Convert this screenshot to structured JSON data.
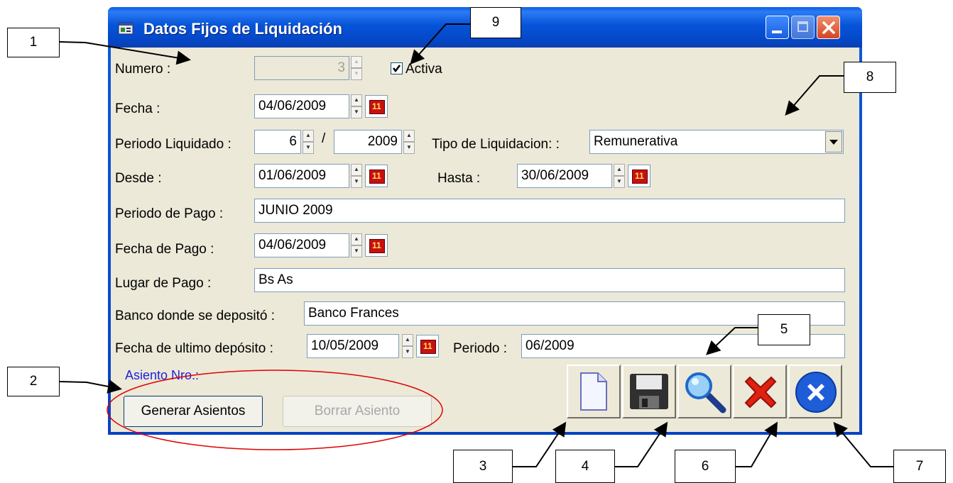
{
  "window": {
    "title": "Datos Fijos de Liquidación"
  },
  "form": {
    "numero_label": "Numero :",
    "numero_value": "3",
    "activa_label": "Activa",
    "activa_checked": true,
    "fecha_label": "Fecha :",
    "fecha_value": "04/06/2009",
    "periodo_liquidado_label": "Periodo Liquidado :",
    "periodo_mes": "6",
    "periodo_sep": "/",
    "periodo_anio": "2009",
    "tipo_label": "Tipo de Liquidacion: :",
    "tipo_value": "Remunerativa",
    "desde_label": "Desde :",
    "desde_value": "01/06/2009",
    "hasta_label": "Hasta :",
    "hasta_value": "30/06/2009",
    "periodo_pago_label": "Periodo de Pago :",
    "periodo_pago_value": "JUNIO 2009",
    "fecha_pago_label": "Fecha de Pago :",
    "fecha_pago_value": "04/06/2009",
    "lugar_pago_label": "Lugar de Pago :",
    "lugar_pago_value": "Bs As",
    "banco_label": "Banco donde se depositó :",
    "banco_value": "Banco Frances",
    "fecha_ultimo_label": "Fecha de ultimo depósito :",
    "fecha_ultimo_value": "10/05/2009",
    "periodo_label": "Periodo :",
    "periodo_value": "06/2009",
    "asiento_label": "Asiento Nro.:"
  },
  "buttons": {
    "generar": "Generar Asientos",
    "borrar": "Borrar Asiento"
  },
  "toolbar": {
    "icons": [
      "new-document-icon",
      "save-floppy-icon",
      "search-magnifier-icon",
      "delete-x-icon",
      "close-exit-icon"
    ]
  },
  "callouts": [
    "1",
    "2",
    "3",
    "4",
    "5",
    "6",
    "7",
    "8",
    "9"
  ],
  "colors": {
    "titlebar": "#0A5FE6",
    "client": "#ECE9D8",
    "asiento_label": "#2020E0",
    "ellipse": "#E00000"
  }
}
